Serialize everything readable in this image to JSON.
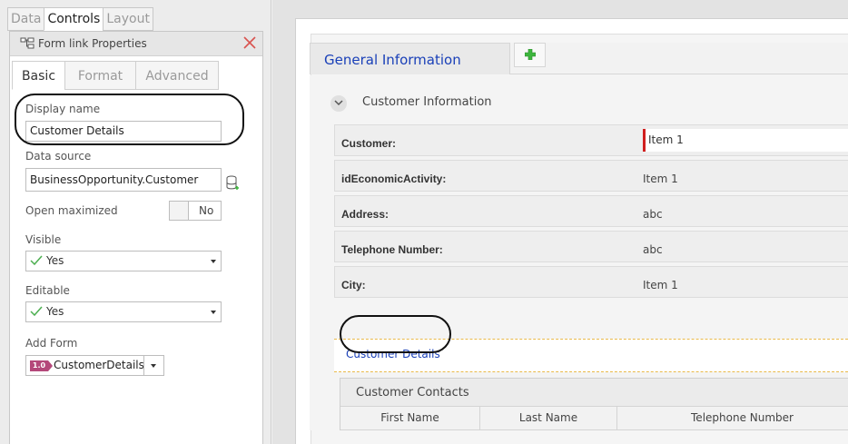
{
  "left_panel": {
    "top_tabs": [
      {
        "label": "Data",
        "active": false
      },
      {
        "label": "Controls",
        "active": true
      },
      {
        "label": "Layout",
        "active": false
      }
    ],
    "properties_title": "Form link Properties",
    "sub_tabs": [
      {
        "label": "Basic",
        "active": true
      },
      {
        "label": "Format",
        "active": false
      },
      {
        "label": "Advanced",
        "active": false
      }
    ],
    "display_name": {
      "label": "Display name",
      "value": "Customer Details"
    },
    "data_source": {
      "label": "Data source",
      "value": "BusinessOpportunity.Customer"
    },
    "open_maximized": {
      "label": "Open maximized",
      "value": "No"
    },
    "visible": {
      "label": "Visible",
      "value": "Yes"
    },
    "editable": {
      "label": "Editable",
      "value": "Yes"
    },
    "add_form": {
      "label": "Add Form",
      "badge": "1.0",
      "value": "CustomerDetails"
    }
  },
  "form": {
    "tab_label": "General Information",
    "section_title": "Customer Information",
    "fields": [
      {
        "label": "Customer:",
        "value": "Item 1"
      },
      {
        "label": "idEconomicActivity:",
        "value": "Item 1"
      },
      {
        "label": "Address:",
        "value": "abc"
      },
      {
        "label": "Telephone Number:",
        "value": "abc"
      },
      {
        "label": "City:",
        "value": "Item 1"
      }
    ],
    "form_link_label": "Customer Details",
    "contacts": {
      "title": "Customer Contacts",
      "columns": [
        "First Name",
        "Last Name",
        "Telephone Number"
      ]
    }
  },
  "colors": {
    "link_blue": "#1a40b8",
    "required_red": "#d01f1f",
    "badge_purple": "#b4487a",
    "check_green": "#4caf50",
    "close_red": "#d9534f",
    "add_green": "#3db53d"
  }
}
